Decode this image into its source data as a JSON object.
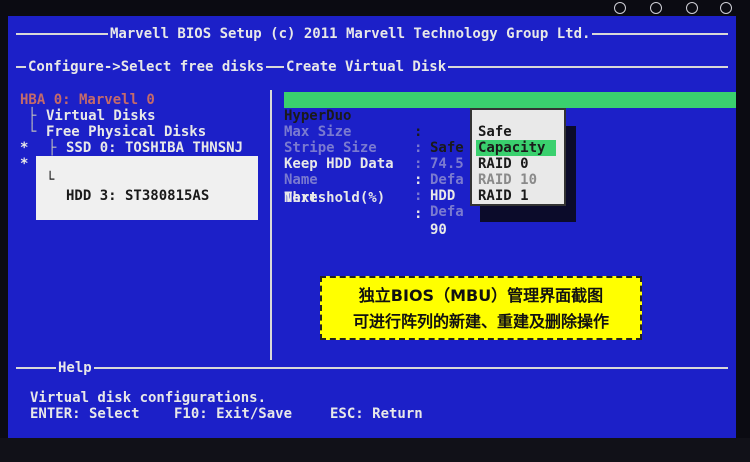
{
  "bios": {
    "title": "Marvell BIOS Setup (c) 2011 Marvell Technology Group Ltd.",
    "breadcrumb": "Configure->Select free disks",
    "panel_title": "Create Virtual Disk",
    "tree": {
      "hba": "HBA 0: Marvell 0",
      "virtual_disks": "Virtual Disks",
      "free_physical_disks": "Free Physical Disks",
      "ssd": {
        "mark": "*",
        "label": "SSD 0: TOSHIBA THNSNJ"
      },
      "hdd": {
        "mark": "*",
        "label": "HDD 3: ST380815AS"
      }
    },
    "settings": {
      "hyperduo": {
        "label": "HyperDuo",
        "sep": ":",
        "value": "Safe"
      },
      "max_size": {
        "label": "Max Size",
        "sep": ":",
        "value": "74.5"
      },
      "stripe_size": {
        "label": "Stripe Size",
        "sep": ":",
        "value": "Defa"
      },
      "keep_hdd_data": {
        "label": "Keep HDD Data",
        "sep": ":",
        "value": "HDD"
      },
      "name": {
        "label": "Name",
        "sep": ":",
        "value": "Defa"
      },
      "threshold": {
        "label": "Threshold(%)",
        "sep": ":",
        "value": "90"
      },
      "next": {
        "label": "Next"
      }
    },
    "popup_options": [
      "Safe",
      "Capacity",
      "RAID 0",
      "RAID 10",
      "RAID 1"
    ],
    "popup_selected": "Capacity",
    "help_label": "Help",
    "help_text": "Virtual disk configurations.",
    "keys": {
      "enter": "ENTER: Select",
      "f10": "F10: Exit/Save",
      "esc": "ESC: Return"
    }
  },
  "caption": {
    "line1": "独立BIOS（MBU）管理界面截图",
    "line2": "可进行阵列的新建、重建及删除操作"
  },
  "colors": {
    "screen_bg": "#1c20c8",
    "highlight_green": "#3ad06e",
    "caption_bg": "#ffff00"
  }
}
